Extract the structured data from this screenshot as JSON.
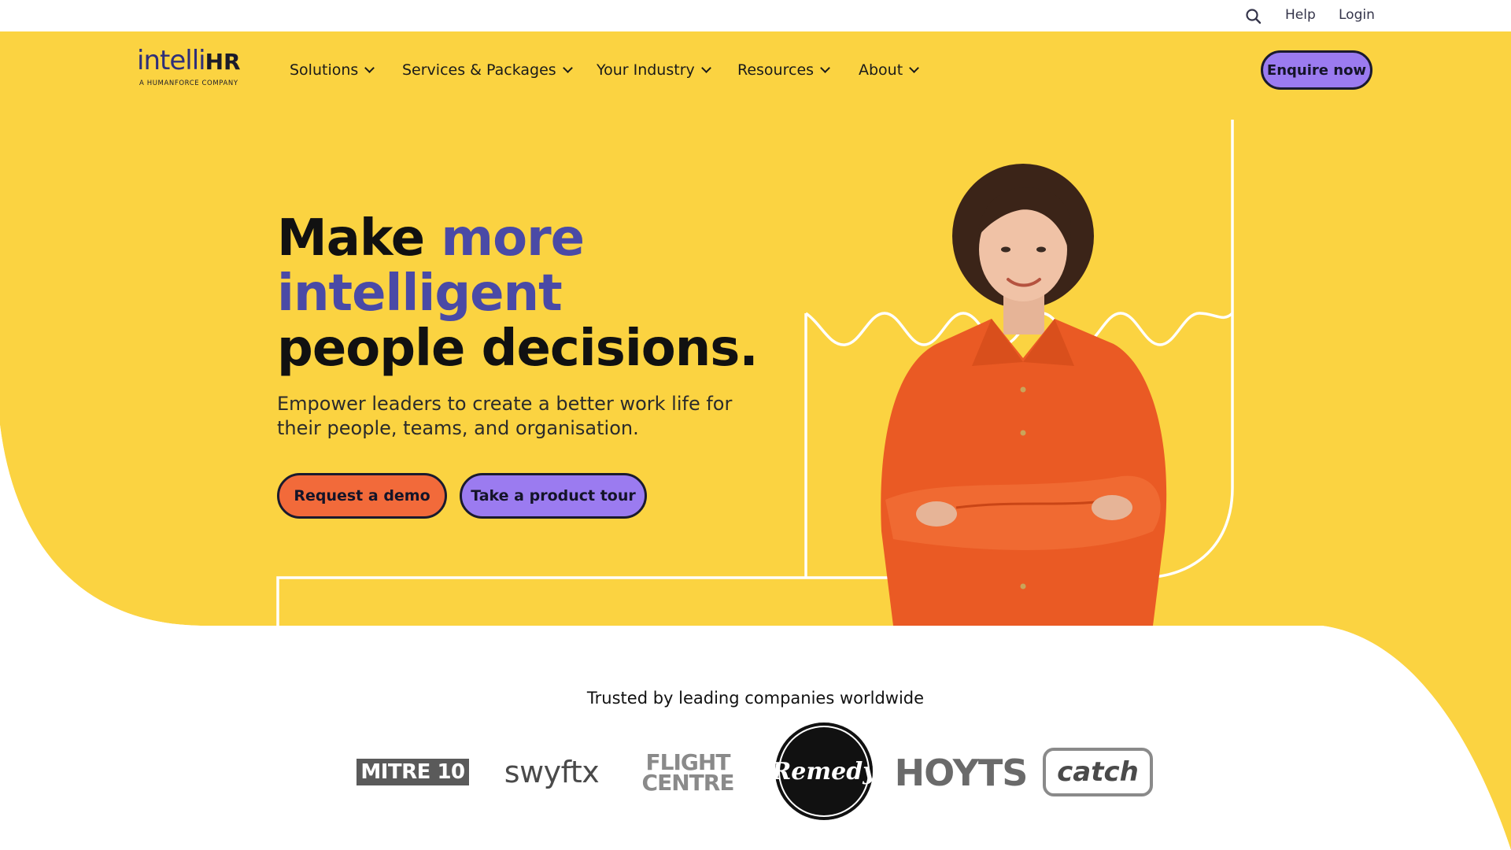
{
  "utility_bar": {
    "search_icon": "search-icon",
    "help": "Help",
    "login": "Login"
  },
  "header": {
    "logo_main": "intelli",
    "logo_hr": "HR",
    "logo_sub": "A HUMANFORCE COMPANY",
    "nav": [
      {
        "label": "Solutions"
      },
      {
        "label": "Services & Packages"
      },
      {
        "label": "Your Industry"
      },
      {
        "label": "Resources"
      },
      {
        "label": "About"
      }
    ],
    "cta": "Enquire now"
  },
  "hero": {
    "headline_1": "Make ",
    "headline_accent_1": "more",
    "headline_accent_2": "intelligent",
    "headline_3": "people decisions.",
    "subtext": "Empower leaders to create a better work life for their people, teams, and organisation.",
    "btn_demo": "Request a demo",
    "btn_tour": "Take a product tour"
  },
  "trusted": {
    "heading": "Trusted by leading companies worldwide",
    "logos": [
      {
        "name": "MITRE 10"
      },
      {
        "name": "swyftx"
      },
      {
        "name_1": "FLIGHT",
        "name_2": "CENTRE"
      },
      {
        "name": "Remedy"
      },
      {
        "name": "HOYTS"
      },
      {
        "name": "catch"
      }
    ]
  },
  "colors": {
    "yellow": "#fbd341",
    "purple_accent": "#4a4aa6",
    "button_purple": "#9b7bf0",
    "button_orange": "#f26a3a",
    "shirt_orange": "#ea5a24"
  }
}
